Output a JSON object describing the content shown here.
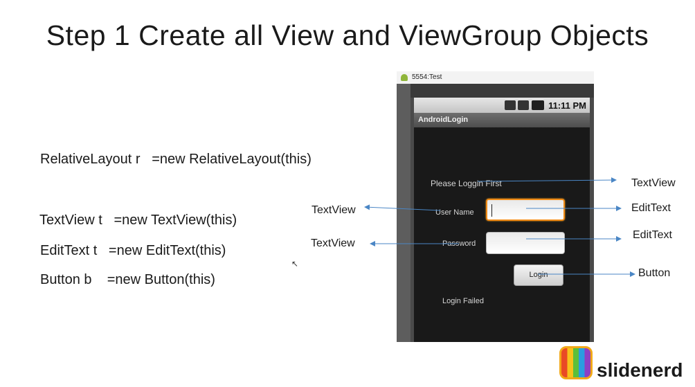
{
  "slide": {
    "title": "Step 1 Create all View and ViewGroup Objects",
    "code_lines": [
      "RelativeLayout r   =new RelativeLayout(this)",
      "TextView t   =new TextView(this)",
      "EditText t   =new EditText(this)",
      "Button b    =new Button(this)"
    ]
  },
  "emulator": {
    "window_title": "5554:Test",
    "status_time": "11:11 PM",
    "app_title": "AndroidLogin",
    "prompt": "Please Loggin First",
    "username_label": "User Name",
    "password_label": "Password",
    "login_button": "Login",
    "result_text": "Login Failed"
  },
  "annotations": {
    "prompt_type": "TextView",
    "username_label_type": "TextView",
    "username_input_type": "EditText",
    "password_label_type": "TextView",
    "password_input_type": "EditText",
    "button_type": "Button"
  },
  "logo": {
    "text": "slidenerd"
  },
  "colors": {
    "arrow": "#4a86c5",
    "focus_border": "#f18b16"
  }
}
